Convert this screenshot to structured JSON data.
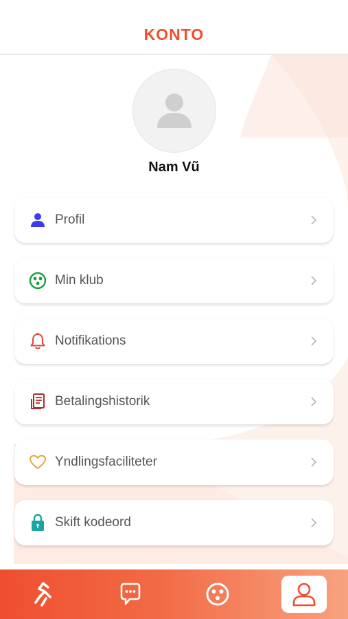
{
  "header": {
    "title": "KONTO"
  },
  "profile": {
    "name": "Nam Vũ",
    "avatar_icon": "user-placeholder-icon"
  },
  "menu": [
    {
      "label": "Profil",
      "icon": "person-icon",
      "color": "#3b3bf0"
    },
    {
      "label": "Min klub",
      "icon": "club-icon",
      "color": "#19a03d"
    },
    {
      "label": "Notifikations",
      "icon": "bell-icon",
      "color": "#e0483a"
    },
    {
      "label": "Betalingshistorik",
      "icon": "receipt-icon",
      "color": "#b22a2a"
    },
    {
      "label": "Yndlingsfaciliteter",
      "icon": "heart-icon",
      "color": "#e7a33c"
    },
    {
      "label": "Skift kodeord",
      "icon": "lock-icon",
      "color": "#1aa5a5"
    }
  ],
  "tabbar": {
    "tabs": [
      {
        "icon": "run-icon",
        "active": false
      },
      {
        "icon": "chat-icon",
        "active": false
      },
      {
        "icon": "club-icon",
        "active": false
      },
      {
        "icon": "account-icon",
        "active": true
      }
    ]
  },
  "colors": {
    "accent": "#ef4e2e",
    "text": "#555555"
  }
}
